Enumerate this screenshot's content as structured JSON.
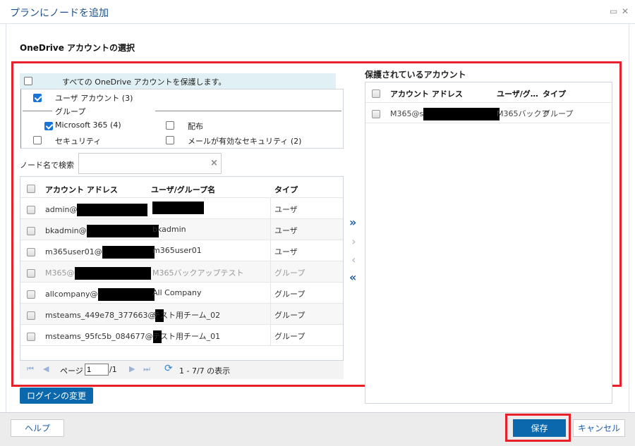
{
  "dialog": {
    "title": "プランにノードを追加",
    "section_title": "OneDrive アカウントの選択"
  },
  "filters": {
    "protect_all": {
      "label": "すべての OneDrive アカウントを保護します。",
      "checked": false
    },
    "user_accounts": {
      "label": "ユーザ アカウント (3)",
      "checked": true
    },
    "group_label": "グループ",
    "microsoft365": {
      "label": "Microsoft 365 (4)",
      "checked": true
    },
    "distribution": {
      "label": "配布",
      "checked": false
    },
    "security": {
      "label": "セキュリティ",
      "checked": false
    },
    "mail_security": {
      "label": "メールが有効なセキュリティ (2)",
      "checked": false
    }
  },
  "search": {
    "label": "ノード名で検索",
    "value": "",
    "clear_icon": "×"
  },
  "left_table": {
    "headers": [
      "アカウント アドレス",
      "ユーザ/グループ名",
      "タイプ"
    ],
    "rows": [
      {
        "account": "admin@",
        "name": "",
        "type": "ユーザ",
        "disabled": false
      },
      {
        "account": "bkadmin@",
        "name": "bkadmin",
        "type": "ユーザ",
        "disabled": false
      },
      {
        "account": "m365user01@",
        "name": "m365user01",
        "type": "ユーザ",
        "disabled": false
      },
      {
        "account": "M365@",
        "name": "M365バックアップテスト",
        "type": "グループ",
        "disabled": true
      },
      {
        "account": "allcompany@",
        "name": "All Company",
        "type": "グループ",
        "disabled": false
      },
      {
        "account": "msteams_449e78_377663@",
        "name": "テスト用チーム_02",
        "type": "グループ",
        "disabled": false
      },
      {
        "account": "msteams_95fc5b_084677@",
        "name": "テスト用チーム_01",
        "type": "グループ",
        "disabled": false
      }
    ]
  },
  "pager": {
    "page_label": "ページ",
    "page": "1",
    "total": "/1",
    "summary": "1 - 7/7 の表示"
  },
  "transfer": {
    "add_all": "»",
    "add": "›",
    "remove": "‹",
    "remove_all": "«"
  },
  "right_panel": {
    "title": "保護されているアカウント",
    "headers": [
      "アカウント アドレス",
      "ユーザ/グ…",
      "タイプ"
    ],
    "rows": [
      {
        "account": "M365@s",
        "name": "M365バックア",
        "type": "グループ"
      }
    ]
  },
  "buttons": {
    "change_login": "ログインの変更",
    "help": "ヘルプ",
    "save": "保存",
    "cancel": "キャンセル"
  },
  "colors": {
    "accent": "#0b68ad",
    "highlight": "#e8202a"
  }
}
